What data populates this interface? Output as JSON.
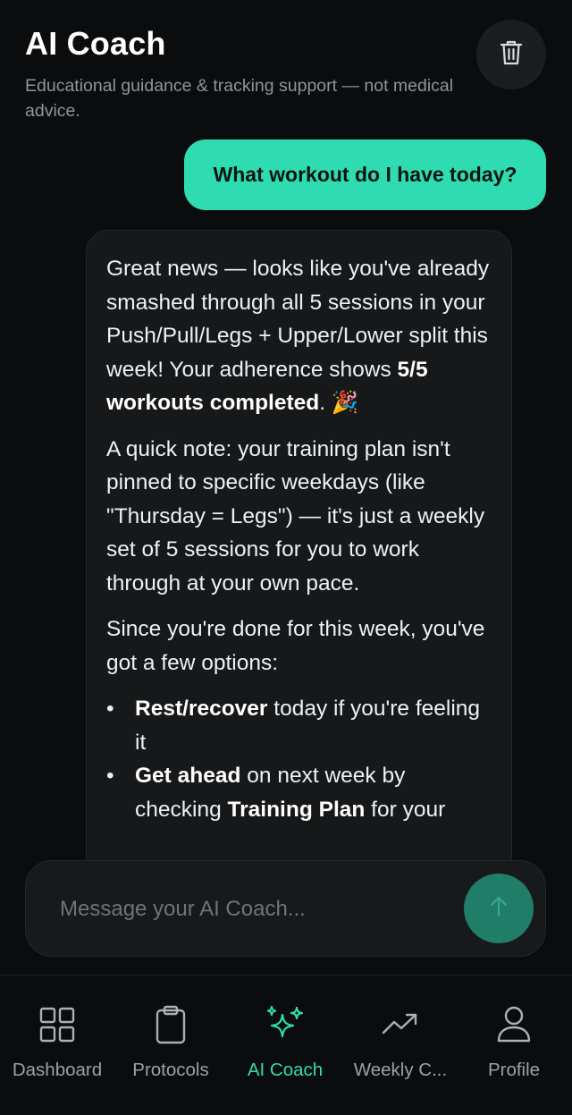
{
  "header": {
    "title": "AI Coach",
    "subtitle": "Educational guidance & tracking support — not medical advice.",
    "clear_icon": "trash-icon"
  },
  "chat": {
    "user_message": "What workout do I have today?",
    "ai_message": {
      "p1_a": "Great news — looks like you've already smashed through all 5 sessions in your Push/Pull/Legs + Upper/Lower split this week! Your adherence shows ",
      "p1_bold": "5/5 workouts completed",
      "p1_b": ". 🎉",
      "p2": "A quick note: your training plan isn't pinned to specific weekdays (like \"Thursday = Legs\") — it's just a weekly set of 5 sessions for you to work through at your own pace.",
      "p3": "Since you're done for this week, you've got a few options:",
      "bullets": [
        {
          "bold": "Rest/recover",
          "text": " today if you're feeling it"
        },
        {
          "bold": "Get ahead",
          "text": " on next week by checking ",
          "bold2": "Training Plan",
          "text2": " for your"
        }
      ]
    }
  },
  "composer": {
    "placeholder": "Message your AI Coach...",
    "send_icon": "arrow-up-icon"
  },
  "nav": {
    "items": [
      {
        "label": "Dashboard",
        "icon": "grid-icon",
        "active": false
      },
      {
        "label": "Protocols",
        "icon": "clipboard-icon",
        "active": false
      },
      {
        "label": "AI Coach",
        "icon": "sparkles-icon",
        "active": true
      },
      {
        "label": "Weekly C...",
        "icon": "trend-up-icon",
        "active": false
      },
      {
        "label": "Profile",
        "icon": "user-icon",
        "active": false
      }
    ]
  },
  "colors": {
    "accent": "#2fdcb2",
    "background": "#0b0c0d",
    "bubble": "#16181a",
    "send_button": "#1f7d68"
  }
}
